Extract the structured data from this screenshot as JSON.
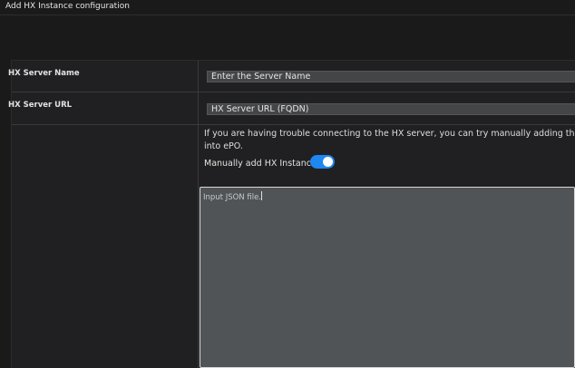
{
  "dialog": {
    "title": "Add HX Instance configuration"
  },
  "form": {
    "server_name": {
      "label": "HX Server Name",
      "value": "Enter the Server Name"
    },
    "server_url": {
      "label": "HX Server URL",
      "value": "HX Server URL (FQDN)"
    },
    "help_text_line1": "If you are having trouble connecting to the HX server, you can try manually adding the HX inst",
    "help_text_line2": "into ePO.",
    "manual_toggle": {
      "label": "Manually add HX Instance",
      "enabled": true,
      "color": "#1e87f0"
    },
    "json_input": {
      "placeholder": "Input JSON file."
    }
  }
}
